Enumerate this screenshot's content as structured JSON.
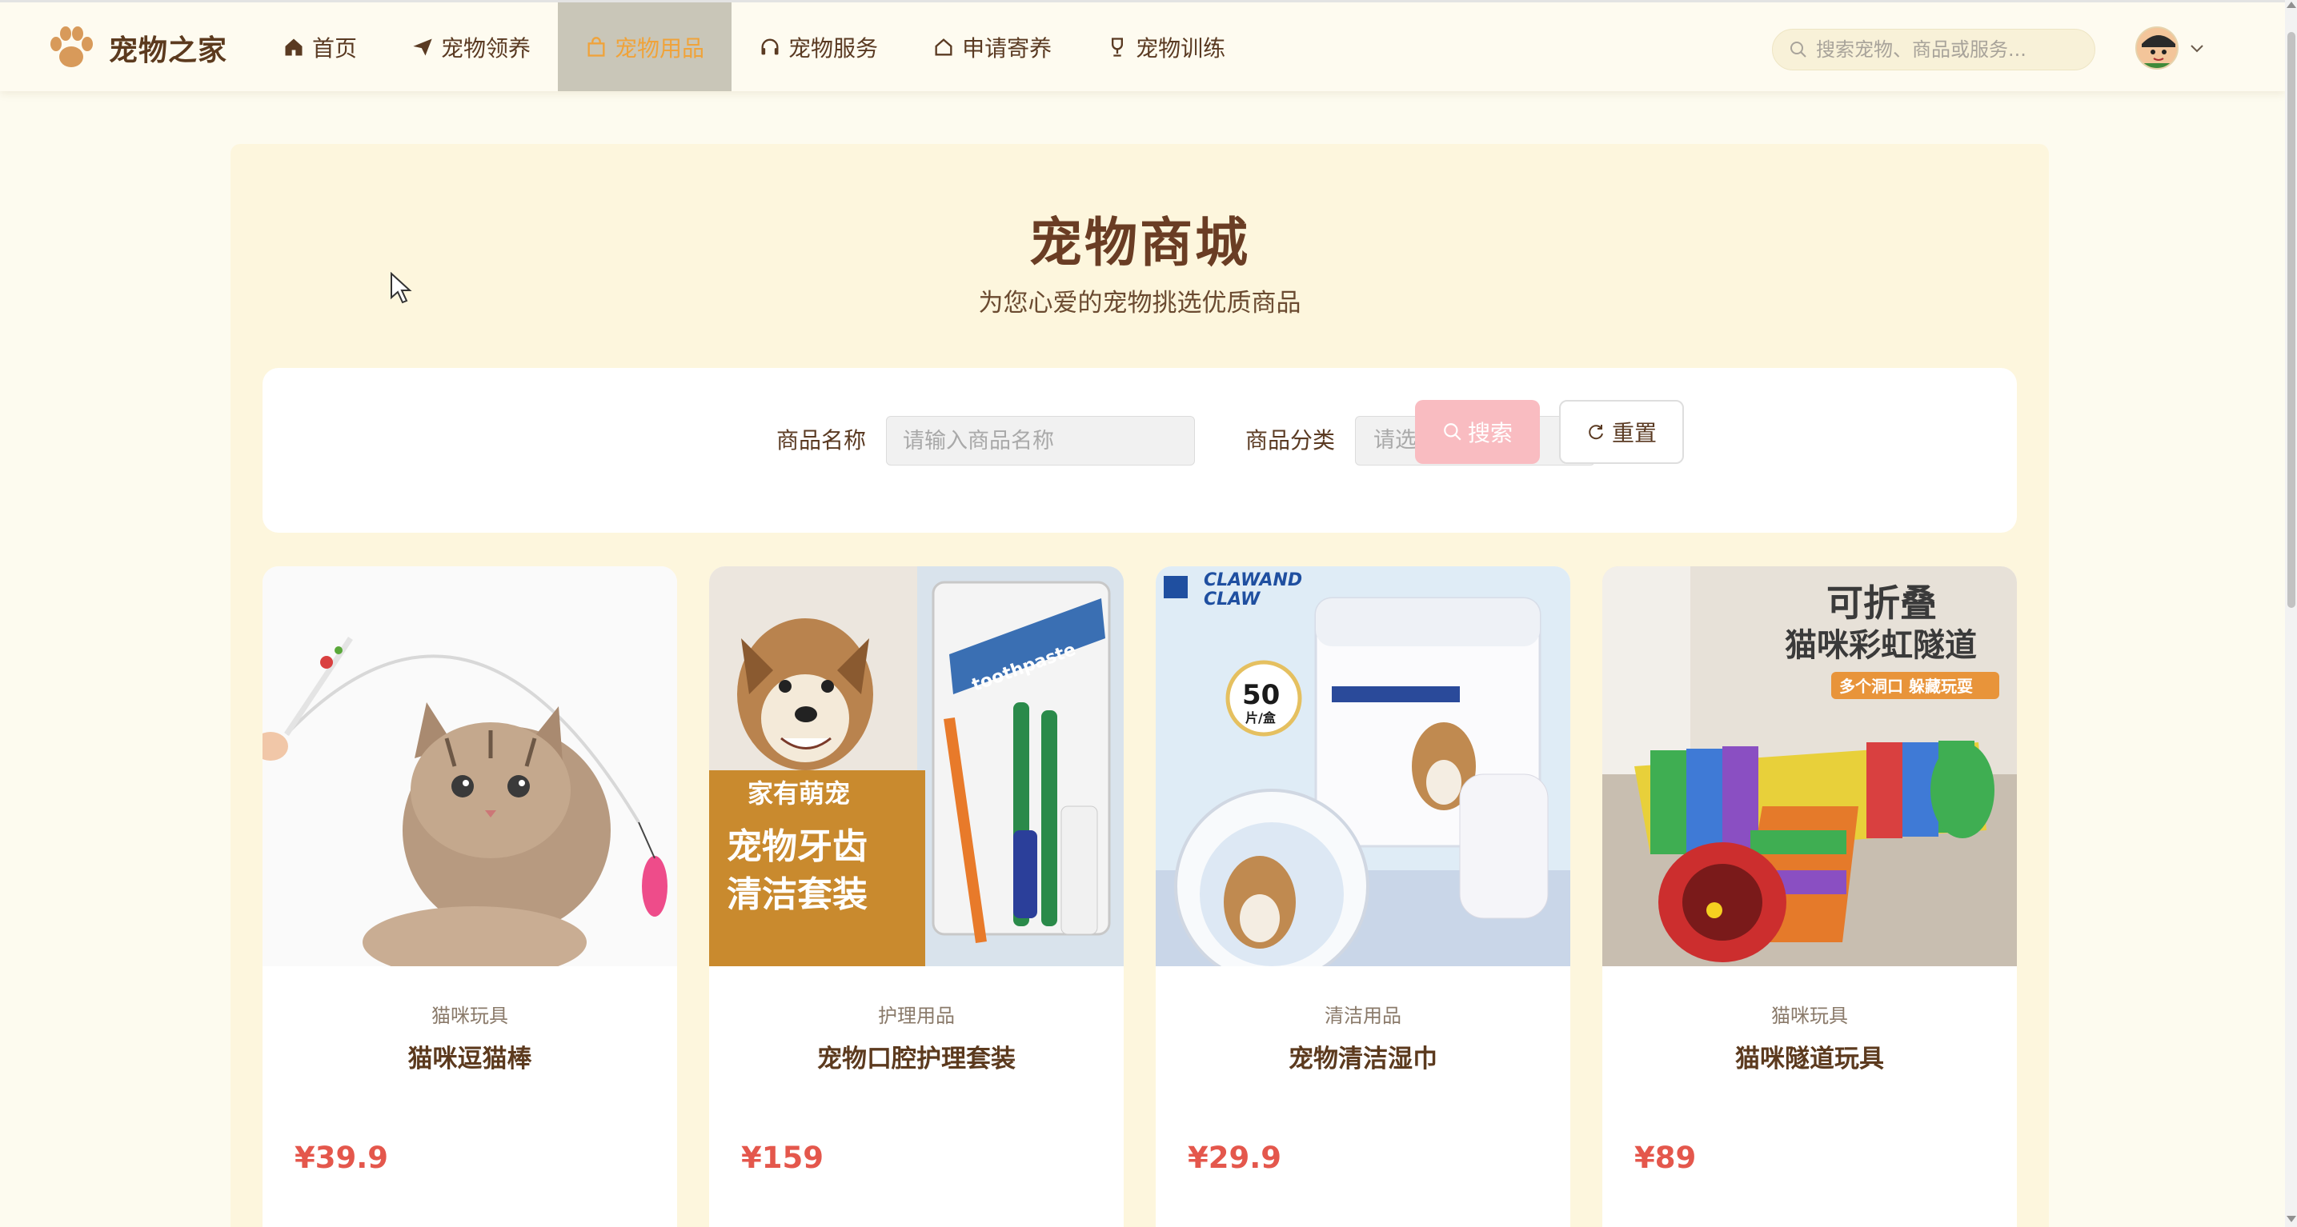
{
  "brand": {
    "name": "宠物之家"
  },
  "nav": [
    {
      "label": "首页",
      "icon": "home-icon",
      "active": false
    },
    {
      "label": "宠物领养",
      "icon": "paper-plane-icon",
      "active": false
    },
    {
      "label": "宠物用品",
      "icon": "shopping-bag-icon",
      "active": true
    },
    {
      "label": "宠物服务",
      "icon": "headset-icon",
      "active": false
    },
    {
      "label": "申请寄养",
      "icon": "house-icon",
      "active": false
    },
    {
      "label": "宠物训练",
      "icon": "trophy-icon",
      "active": false
    }
  ],
  "header": {
    "search_placeholder": "搜索宠物、商品或服务..."
  },
  "page": {
    "title": "宠物商城",
    "subtitle": "为您心爱的宠物挑选优质商品"
  },
  "filters": {
    "name_label": "商品名称",
    "name_placeholder": "请输入商品名称",
    "category_label": "商品分类",
    "category_placeholder": "请选择分类",
    "search_button": "搜索",
    "reset_button": "重置"
  },
  "products": [
    {
      "category": "猫咪玩具",
      "name": "猫咪逗猫棒",
      "price": "¥39.9"
    },
    {
      "category": "护理用品",
      "name": "宠物口腔护理套装",
      "price": "¥159",
      "image_text": [
        "宠物牙齿",
        "清洁套装",
        "家有萌宠",
        "toothpaste"
      ]
    },
    {
      "category": "清洁用品",
      "name": "宠物清洁湿巾",
      "price": "¥29.9",
      "image_text": [
        "CLAWAND",
        "CLAW",
        "50",
        "片/盒"
      ]
    },
    {
      "category": "猫咪玩具",
      "name": "猫咪隧道玩具",
      "price": "¥89",
      "image_text": [
        "可折叠",
        "猫咪彩虹隧道",
        "多个洞口 躲藏玩耍"
      ]
    }
  ],
  "colors": {
    "accent": "#f0a33a",
    "price": "#e4574c",
    "search_button": "#f9bcc1",
    "brand_text": "#5c3a1e",
    "background": "#fdfbef"
  }
}
